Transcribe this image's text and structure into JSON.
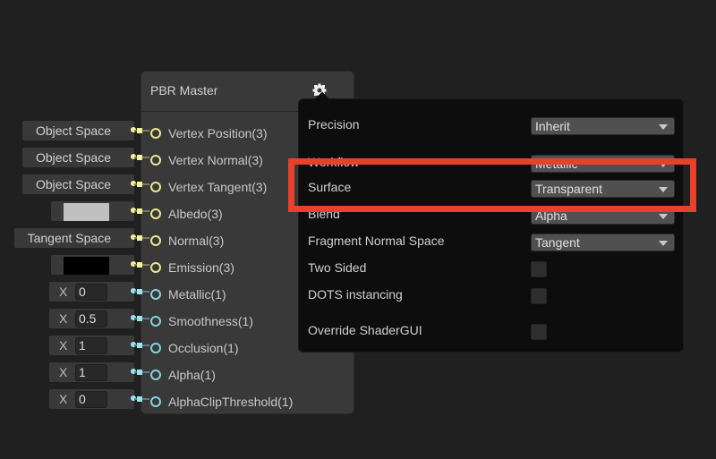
{
  "node": {
    "title": "PBR Master",
    "settings_icon": "gear-icon",
    "ports": [
      {
        "label": "Vertex Position(3)",
        "type": "vector",
        "input": {
          "kind": "space",
          "value": "Object Space"
        }
      },
      {
        "label": "Vertex Normal(3)",
        "type": "vector",
        "input": {
          "kind": "space",
          "value": "Object Space"
        }
      },
      {
        "label": "Vertex Tangent(3)",
        "type": "vector",
        "input": {
          "kind": "space",
          "value": "Object Space"
        }
      },
      {
        "label": "Albedo(3)",
        "type": "vector",
        "input": {
          "kind": "color",
          "value": "#c0c0c0"
        }
      },
      {
        "label": "Normal(3)",
        "type": "vector",
        "input": {
          "kind": "space",
          "value": "Tangent Space"
        }
      },
      {
        "label": "Emission(3)",
        "type": "vector",
        "input": {
          "kind": "color",
          "value": "#000000"
        }
      },
      {
        "label": "Metallic(1)",
        "type": "float",
        "input": {
          "kind": "float",
          "axis": "X",
          "value": "0"
        }
      },
      {
        "label": "Smoothness(1)",
        "type": "float",
        "input": {
          "kind": "float",
          "axis": "X",
          "value": "0.5"
        }
      },
      {
        "label": "Occlusion(1)",
        "type": "float",
        "input": {
          "kind": "float",
          "axis": "X",
          "value": "1"
        }
      },
      {
        "label": "Alpha(1)",
        "type": "float",
        "input": {
          "kind": "float",
          "axis": "X",
          "value": "1"
        }
      },
      {
        "label": "AlphaClipThreshold(1)",
        "type": "float",
        "input": {
          "kind": "float",
          "axis": "X",
          "value": "0"
        }
      }
    ]
  },
  "settings_popup": {
    "properties": [
      {
        "label": "Precision",
        "kind": "dropdown",
        "value": "Inherit"
      },
      {
        "label": "Workflow",
        "kind": "dropdown",
        "value": "Metallic"
      },
      {
        "label": "Surface",
        "kind": "dropdown",
        "value": "Transparent",
        "highlighted": true
      },
      {
        "label": "Blend",
        "kind": "dropdown",
        "value": "Alpha"
      },
      {
        "label": "Fragment Normal Space",
        "kind": "dropdown",
        "value": "Tangent"
      },
      {
        "label": "Two Sided",
        "kind": "checkbox",
        "checked": false
      },
      {
        "label": "DOTS instancing",
        "kind": "checkbox",
        "checked": false
      },
      {
        "label": "Override ShaderGUI",
        "kind": "checkbox",
        "checked": false
      }
    ]
  },
  "colors": {
    "vector_port": "#e8e890",
    "float_port": "#84d4e4",
    "highlight": "#e8402a"
  }
}
